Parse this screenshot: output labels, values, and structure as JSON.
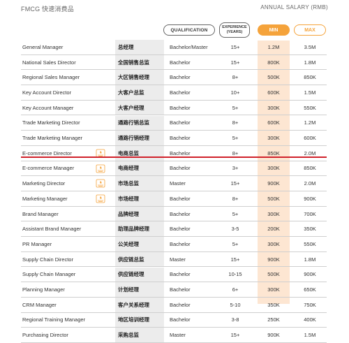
{
  "header": {
    "left_title": "FMCG 快速消费品",
    "right_title": "ANNUAL SALARY (RMB)",
    "qualification": "QUALIFICATION",
    "experience_line1": "EXPERIENCE",
    "experience_line2": "(YEARS)",
    "min": "MIN",
    "max": "MAX"
  },
  "colors": {
    "accent": "#f5a33b",
    "min_col": "#fde6d2",
    "highlight_line": "#d0212a"
  },
  "rows": [
    {
      "title": "General Manager",
      "cn": "总经理",
      "qual": "Bachelor/Master",
      "exp": "15+",
      "min": "1.2M",
      "max": "3.5M",
      "hot": false
    },
    {
      "title": "National Sales Director",
      "cn": "全国销售总监",
      "qual": "Bachelor",
      "exp": "15+",
      "min": "800K",
      "max": "1.8M",
      "hot": false
    },
    {
      "title": "Regional Sales Manager",
      "cn": "大区销售经理",
      "qual": "Bachelor",
      "exp": "8+",
      "min": "500K",
      "max": "850K",
      "hot": false
    },
    {
      "title": "Key Account Director",
      "cn": "大客户总监",
      "qual": "Bachelor",
      "exp": "10+",
      "min": "600K",
      "max": "1.5M",
      "hot": false
    },
    {
      "title": "Key Account Manager",
      "cn": "大客户经理",
      "qual": "Bachelor",
      "exp": "5+",
      "min": "300K",
      "max": "550K",
      "hot": false
    },
    {
      "title": "Trade Marketing Director",
      "cn": "通路行销总监",
      "qual": "Bachelor",
      "exp": "8+",
      "min": "600K",
      "max": "1.2M",
      "hot": false
    },
    {
      "title": "Trade Marketing Manager",
      "cn": "通路行销经理",
      "qual": "Bachelor",
      "exp": "5+",
      "min": "300K",
      "max": "600K",
      "hot": false
    },
    {
      "title": "E-commerce Director",
      "cn": "电商总监",
      "qual": "Bachelor",
      "exp": "8+",
      "min": "850K",
      "max": "2.0M",
      "hot": true
    },
    {
      "title": "E-commerce Manager",
      "cn": "电商经理",
      "qual": "Bachelor",
      "exp": "3+",
      "min": "300K",
      "max": "850K",
      "hot": true
    },
    {
      "title": "Marketing Director",
      "cn": "市场总监",
      "qual": "Master",
      "exp": "15+",
      "min": "900K",
      "max": "2.0M",
      "hot": true
    },
    {
      "title": "Marketing Manager",
      "cn": "市场经理",
      "qual": "Bachelor",
      "exp": "8+",
      "min": "500K",
      "max": "900K",
      "hot": true
    },
    {
      "title": "Brand Manager",
      "cn": "品牌经理",
      "qual": "Bachelor",
      "exp": "5+",
      "min": "300K",
      "max": "700K",
      "hot": false
    },
    {
      "title": "Assistant Brand Manager",
      "cn": "助理品牌经理",
      "qual": "Bachelor",
      "exp": "3-5",
      "min": "200K",
      "max": "350K",
      "hot": false
    },
    {
      "title": "PR Manager",
      "cn": "公关经理",
      "qual": "Bachelor",
      "exp": "5+",
      "min": "300K",
      "max": "550K",
      "hot": false
    },
    {
      "title": "Supply Chain Director",
      "cn": "供应链总监",
      "qual": "Master",
      "exp": "15+",
      "min": "900K",
      "max": "1.8M",
      "hot": false
    },
    {
      "title": "Supply Chain Manager",
      "cn": "供应链经理",
      "qual": "Bachelor",
      "exp": "10-15",
      "min": "500K",
      "max": "900K",
      "hot": false
    },
    {
      "title": "Planning Manager",
      "cn": "计划经理",
      "qual": "Bachelor",
      "exp": "6+",
      "min": "300K",
      "max": "650K",
      "hot": false
    },
    {
      "title": "CRM Manager",
      "cn": "客户关系经理",
      "qual": "Bachelor",
      "exp": "5-10",
      "min": "350K",
      "max": "750K",
      "hot": false
    },
    {
      "title": "Regional Training Manager",
      "cn": "地区培训经理",
      "qual": "Bachelor",
      "exp": "3-8",
      "min": "250K",
      "max": "400K",
      "hot": false
    },
    {
      "title": "Purchasing Director",
      "cn": "采购总监",
      "qual": "Master",
      "exp": "15+",
      "min": "900K",
      "max": "1.5M",
      "hot": false
    }
  ]
}
